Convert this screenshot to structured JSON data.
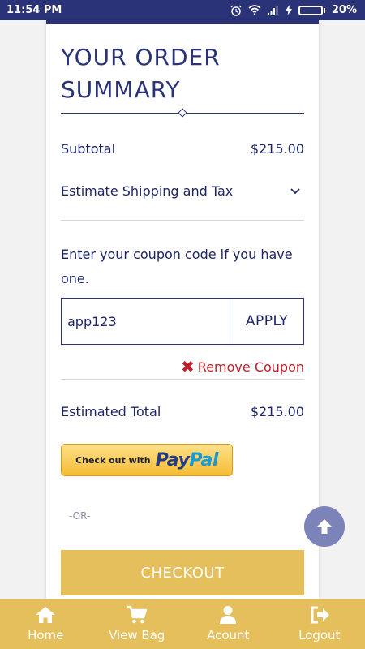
{
  "status_bar": {
    "time": "11:54 PM",
    "battery_percent": "20%",
    "battery_level": 0.2,
    "icons": [
      "alarm-icon",
      "wifi-icon",
      "signal-icon",
      "charging-icon",
      "battery-icon"
    ]
  },
  "order_summary": {
    "title_line1": "YOUR ORDER",
    "title_line2": "SUMMARY",
    "subtotal_label": "Subtotal",
    "subtotal_value": "$215.00",
    "shipping_label": "Estimate Shipping and Tax",
    "coupon_prompt": "Enter your coupon code if you have one.",
    "coupon_value": "app123",
    "apply_label": "APPLY",
    "remove_coupon_label": "Remove Coupon",
    "estimated_total_label": "Estimated Total",
    "estimated_total_value": "$215.00",
    "paypal_prefix": "Check out with",
    "paypal_pay": "Pay",
    "paypal_pal": "Pal",
    "or_label": "-OR-",
    "checkout_label": "CHECKOUT"
  },
  "bottom_nav": {
    "items": [
      {
        "label": "Home",
        "icon": "home-icon"
      },
      {
        "label": "View Bag",
        "icon": "cart-icon"
      },
      {
        "label": "Acount",
        "icon": "user-icon"
      },
      {
        "label": "Logout",
        "icon": "logout-icon"
      }
    ]
  },
  "colors": {
    "primary": "#2a3278",
    "accent_gold": "#e5bf5b",
    "remove_red": "#c0202b",
    "fab": "#7b83b8"
  }
}
